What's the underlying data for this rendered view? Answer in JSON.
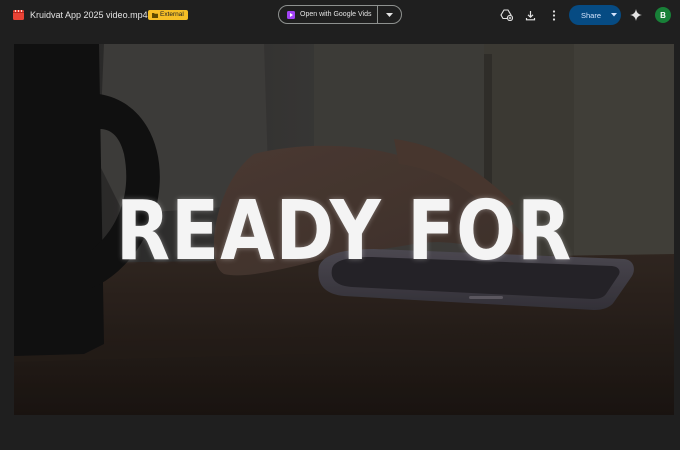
{
  "header": {
    "file_name": "Kruidvat App 2025 video.mp4",
    "badge_label": "External",
    "open_with_label": "Open with Google Vids",
    "share_label": "Share",
    "avatar_letter": "B"
  },
  "video": {
    "overlay_text": "READY FOR"
  },
  "icons": {
    "file": "video-file-icon",
    "badge": "folder-shared-icon",
    "open_with": "google-vids-icon",
    "open_caret": "chevron-down-icon",
    "add_shortcut": "add-to-drive-icon",
    "download": "download-icon",
    "more": "more-vert-icon",
    "share_caret": "chevron-down-icon",
    "gemini": "gemini-sparkle-icon"
  },
  "colors": {
    "background": "#1f1f1f",
    "badge": "#f6bf26",
    "share_button": "#064b83",
    "avatar": "#188038",
    "file_icon": "#ea4335",
    "vids_icon": "#a142f4"
  }
}
